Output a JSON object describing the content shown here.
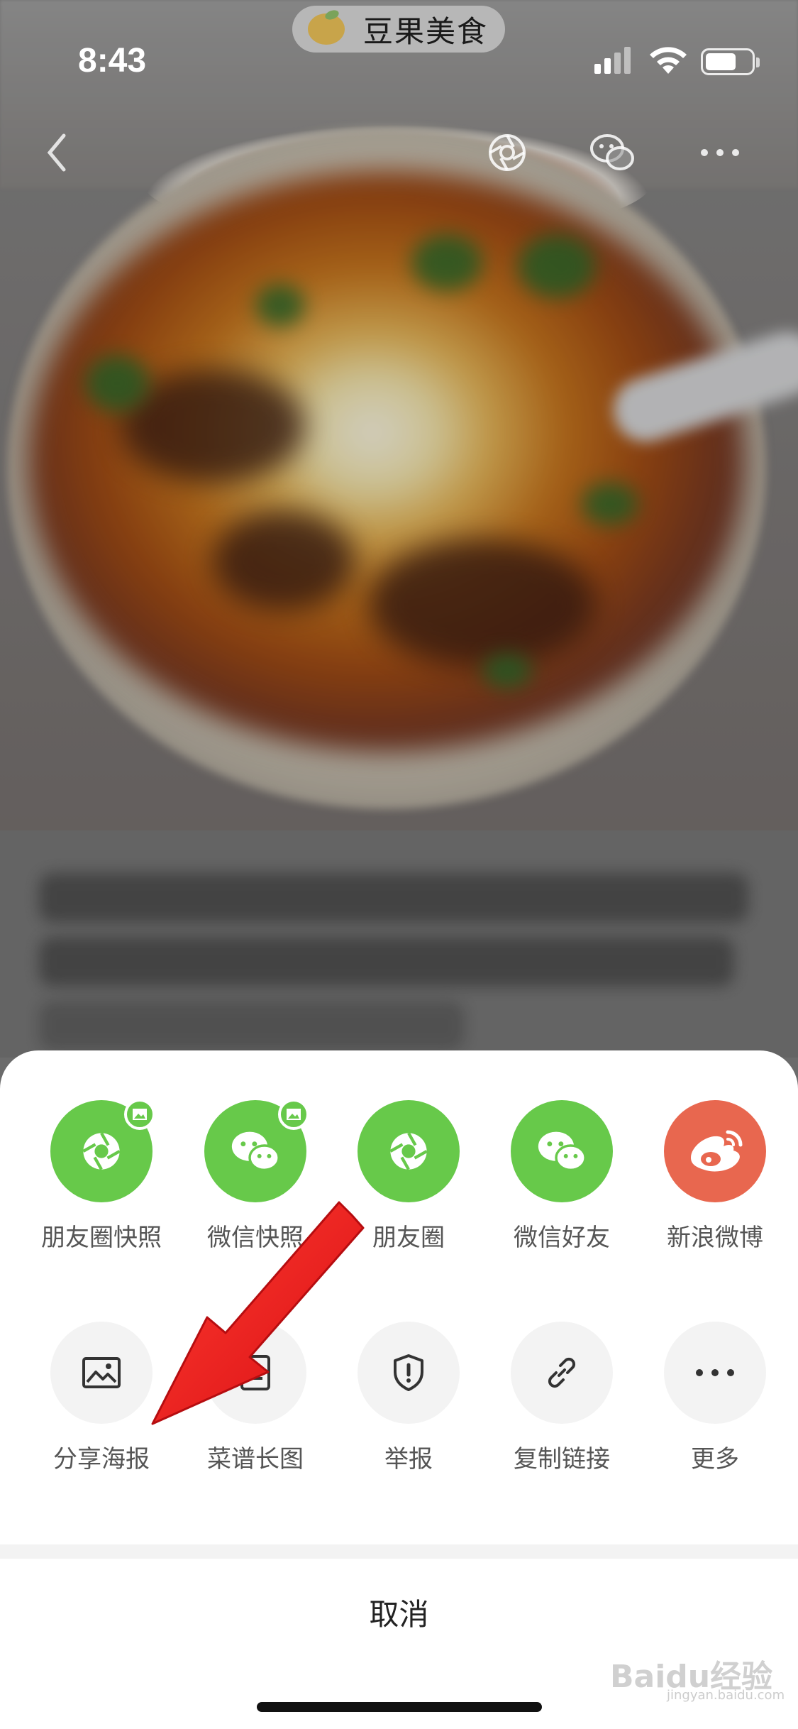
{
  "status_bar": {
    "time": "8:43",
    "app_pill_name": "豆果美食"
  },
  "share_sheet": {
    "row1": [
      {
        "label": "朋友圈快照",
        "icon": "moments-snapshot-icon",
        "color": "#67c94a"
      },
      {
        "label": "微信快照",
        "icon": "wechat-snapshot-icon",
        "color": "#67c94a"
      },
      {
        "label": "朋友圈",
        "icon": "moments-icon",
        "color": "#67c94a"
      },
      {
        "label": "微信好友",
        "icon": "wechat-friend-icon",
        "color": "#67c94a"
      },
      {
        "label": "新浪微博",
        "icon": "weibo-icon",
        "color": "#e8674f"
      }
    ],
    "row2": [
      {
        "label": "分享海报",
        "icon": "poster-icon"
      },
      {
        "label": "菜谱长图",
        "icon": "long-image-icon"
      },
      {
        "label": "举报",
        "icon": "report-shield-icon"
      },
      {
        "label": "复制链接",
        "icon": "link-icon"
      },
      {
        "label": "更多",
        "icon": "more-icon"
      }
    ],
    "cancel_label": "取消"
  },
  "watermark": {
    "brand": "Baidu经验",
    "url": "jingyan.baidu.com"
  },
  "colors": {
    "wechat_green": "#67c94a",
    "weibo_red": "#e8674f",
    "annotation_arrow": "#e3141b"
  }
}
